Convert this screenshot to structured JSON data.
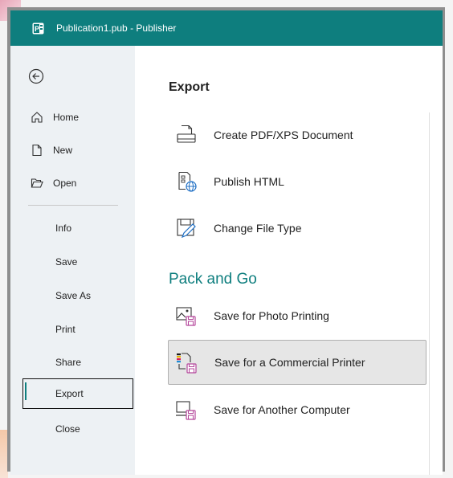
{
  "window": {
    "title": "Publication1.pub  -  Publisher"
  },
  "sidebar": {
    "items": [
      {
        "label": "Home",
        "icon": "home-icon"
      },
      {
        "label": "New",
        "icon": "new-doc-icon"
      },
      {
        "label": "Open",
        "icon": "folder-open-icon"
      },
      {
        "label": "Info"
      },
      {
        "label": "Save"
      },
      {
        "label": "Save As"
      },
      {
        "label": "Print"
      },
      {
        "label": "Share"
      },
      {
        "label": "Export",
        "active": true
      },
      {
        "label": "Close"
      }
    ]
  },
  "main": {
    "heading": "Export",
    "export_options": [
      {
        "label": "Create PDF/XPS Document",
        "icon": "pdf-document-icon"
      },
      {
        "label": "Publish HTML",
        "icon": "html-globe-icon"
      },
      {
        "label": "Change File Type",
        "icon": "change-file-type-icon"
      }
    ],
    "pack_section_title": "Pack and Go",
    "pack_options": [
      {
        "label": "Save for Photo Printing",
        "icon": "photo-printing-icon"
      },
      {
        "label": "Save for a Commercial Printer",
        "icon": "commercial-printer-icon",
        "selected": true
      },
      {
        "label": "Save for Another Computer",
        "icon": "another-computer-icon"
      }
    ]
  },
  "colors": {
    "accent": "#0e7e7e",
    "sidebar_bg": "#edf1f4",
    "selected_bg": "#e6e6e6",
    "save_purple": "#b4469b"
  }
}
